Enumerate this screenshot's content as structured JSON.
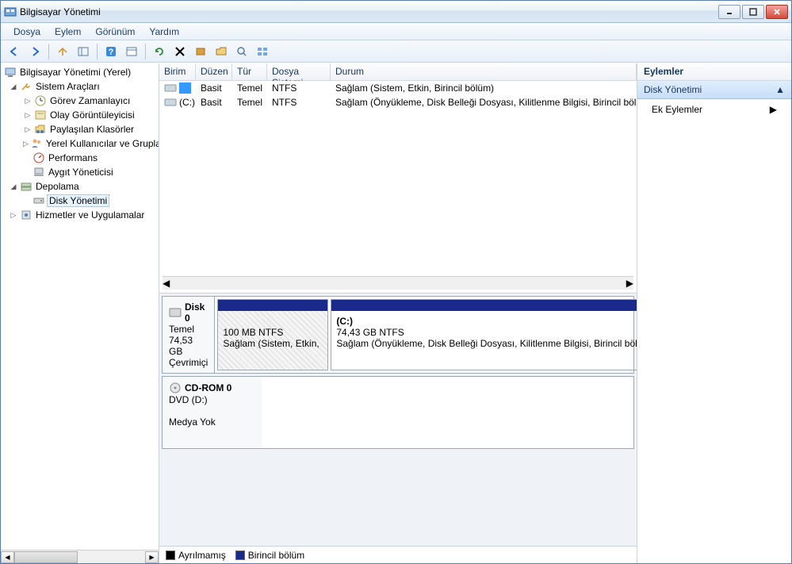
{
  "title": "Bilgisayar Yönetimi",
  "menu": {
    "file": "Dosya",
    "action": "Eylem",
    "view": "Görünüm",
    "help": "Yardım"
  },
  "tree": {
    "root": "Bilgisayar Yönetimi (Yerel)",
    "system_tools": "Sistem Araçları",
    "task_scheduler": "Görev Zamanlayıcı",
    "event_viewer": "Olay Görüntüleyicisi",
    "shared_folders": "Paylaşılan Klasörler",
    "local_users": "Yerel Kullanıcılar ve Gruplar",
    "performance": "Performans",
    "device_manager": "Aygıt Yöneticisi",
    "storage": "Depolama",
    "disk_management": "Disk Yönetimi",
    "services_apps": "Hizmetler ve Uygulamalar"
  },
  "columns": {
    "volume": "Birim",
    "layout": "Düzen",
    "type": "Tür",
    "fs": "Dosya Sistemi",
    "status": "Durum"
  },
  "volumes": [
    {
      "name": "",
      "layout": "Basit",
      "type": "Temel",
      "fs": "NTFS",
      "status": "Sağlam (Sistem, Etkin, Birincil bölüm)"
    },
    {
      "name": "(C:)",
      "layout": "Basit",
      "type": "Temel",
      "fs": "NTFS",
      "status": "Sağlam (Önyükleme, Disk Belleği Dosyası, Kilitlenme Bilgisi, Birincil bölüm)"
    }
  ],
  "disk0": {
    "name": "Disk 0",
    "type": "Temel",
    "size": "74,53 GB",
    "status": "Çevrimiçi",
    "part1_line1": "100 MB NTFS",
    "part1_line2": "Sağlam (Sistem, Etkin, Birincil bölüm)",
    "part2_label": "(C:)",
    "part2_line1": "74,43 GB NTFS",
    "part2_line2": "Sağlam (Önyükleme, Disk Belleği Dosyası, Kilitlenme Bilgisi, Birincil bölüm)"
  },
  "cdrom": {
    "name": "CD-ROM 0",
    "type": "DVD (D:)",
    "media": "Medya Yok"
  },
  "legend": {
    "unallocated": "Ayrılmamış",
    "primary": "Birincil bölüm"
  },
  "actions": {
    "header": "Eylemler",
    "disk_management": "Disk Yönetimi",
    "more": "Ek Eylemler"
  }
}
